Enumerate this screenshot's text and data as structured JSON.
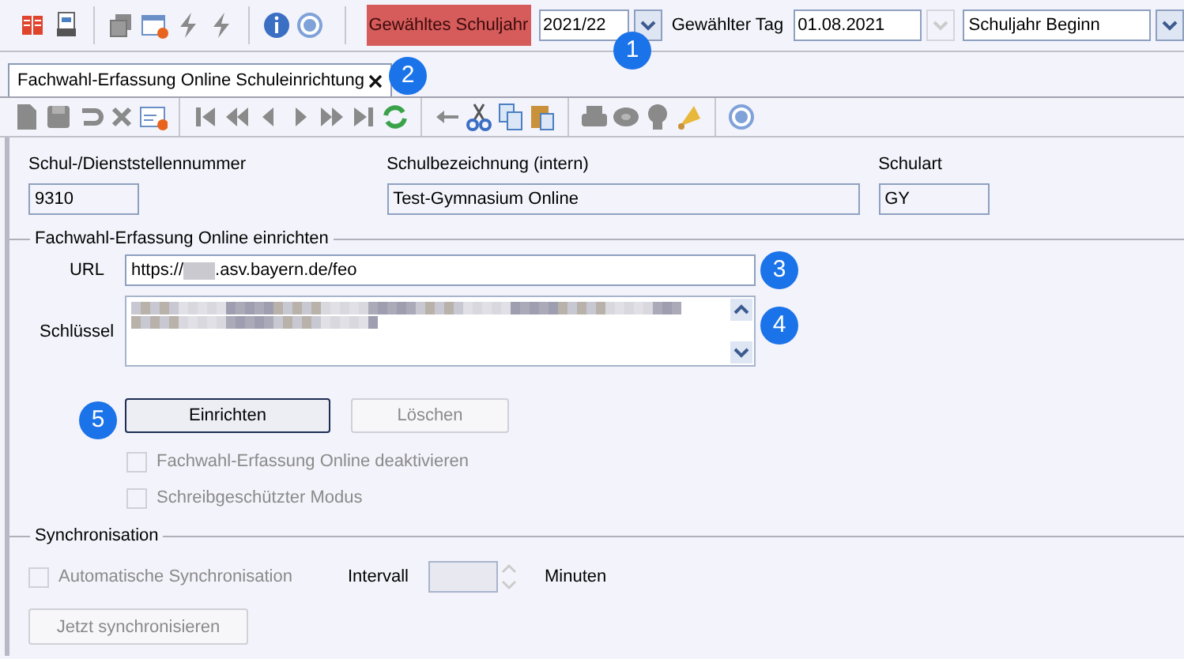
{
  "top_bar": {
    "school_year_label": "Gewähltes Schuljahr",
    "school_year": "2021/22",
    "day_label": "Gewählter Tag",
    "day": "01.08.2021",
    "day_mode": "Schuljahr Beginn"
  },
  "tabs": [
    {
      "label": "Fachwahl-Erfassung Online Schuleinrichtung",
      "selected": true
    }
  ],
  "school_fields": [
    {
      "label": "Schul-/Dienststellennummer",
      "value": "9310"
    },
    {
      "label": "Schulbezeichnung (intern)",
      "value": "Test-Gymnasium Online"
    },
    {
      "label": "Schulart",
      "value": "GY"
    }
  ],
  "setup": {
    "title": "Fachwahl-Erfassung Online einrichten",
    "url_label": "URL",
    "url_prefix": "https://",
    "url_suffix": ".asv.bayern.de/feo",
    "key_label": "Schlüssel",
    "buttons": [
      {
        "label": "Einrichten",
        "disabled": false
      },
      {
        "label": "Löschen",
        "disabled": true
      }
    ],
    "options": [
      {
        "label": "Fachwahl-Erfassung Online deaktivieren",
        "checked": false,
        "disabled": true
      },
      {
        "label": "Schreibgeschützter Modus",
        "checked": false,
        "disabled": true
      }
    ]
  },
  "sync": {
    "title": "Synchronisation",
    "auto": {
      "label": "Automatische Synchronisation",
      "checked": false,
      "disabled": true
    },
    "interval_label": "Intervall",
    "unit": "Minuten",
    "button": {
      "label": "Jetzt synchronisieren",
      "disabled": true
    }
  },
  "callouts": [
    "1",
    "2",
    "3",
    "4",
    "5"
  ]
}
